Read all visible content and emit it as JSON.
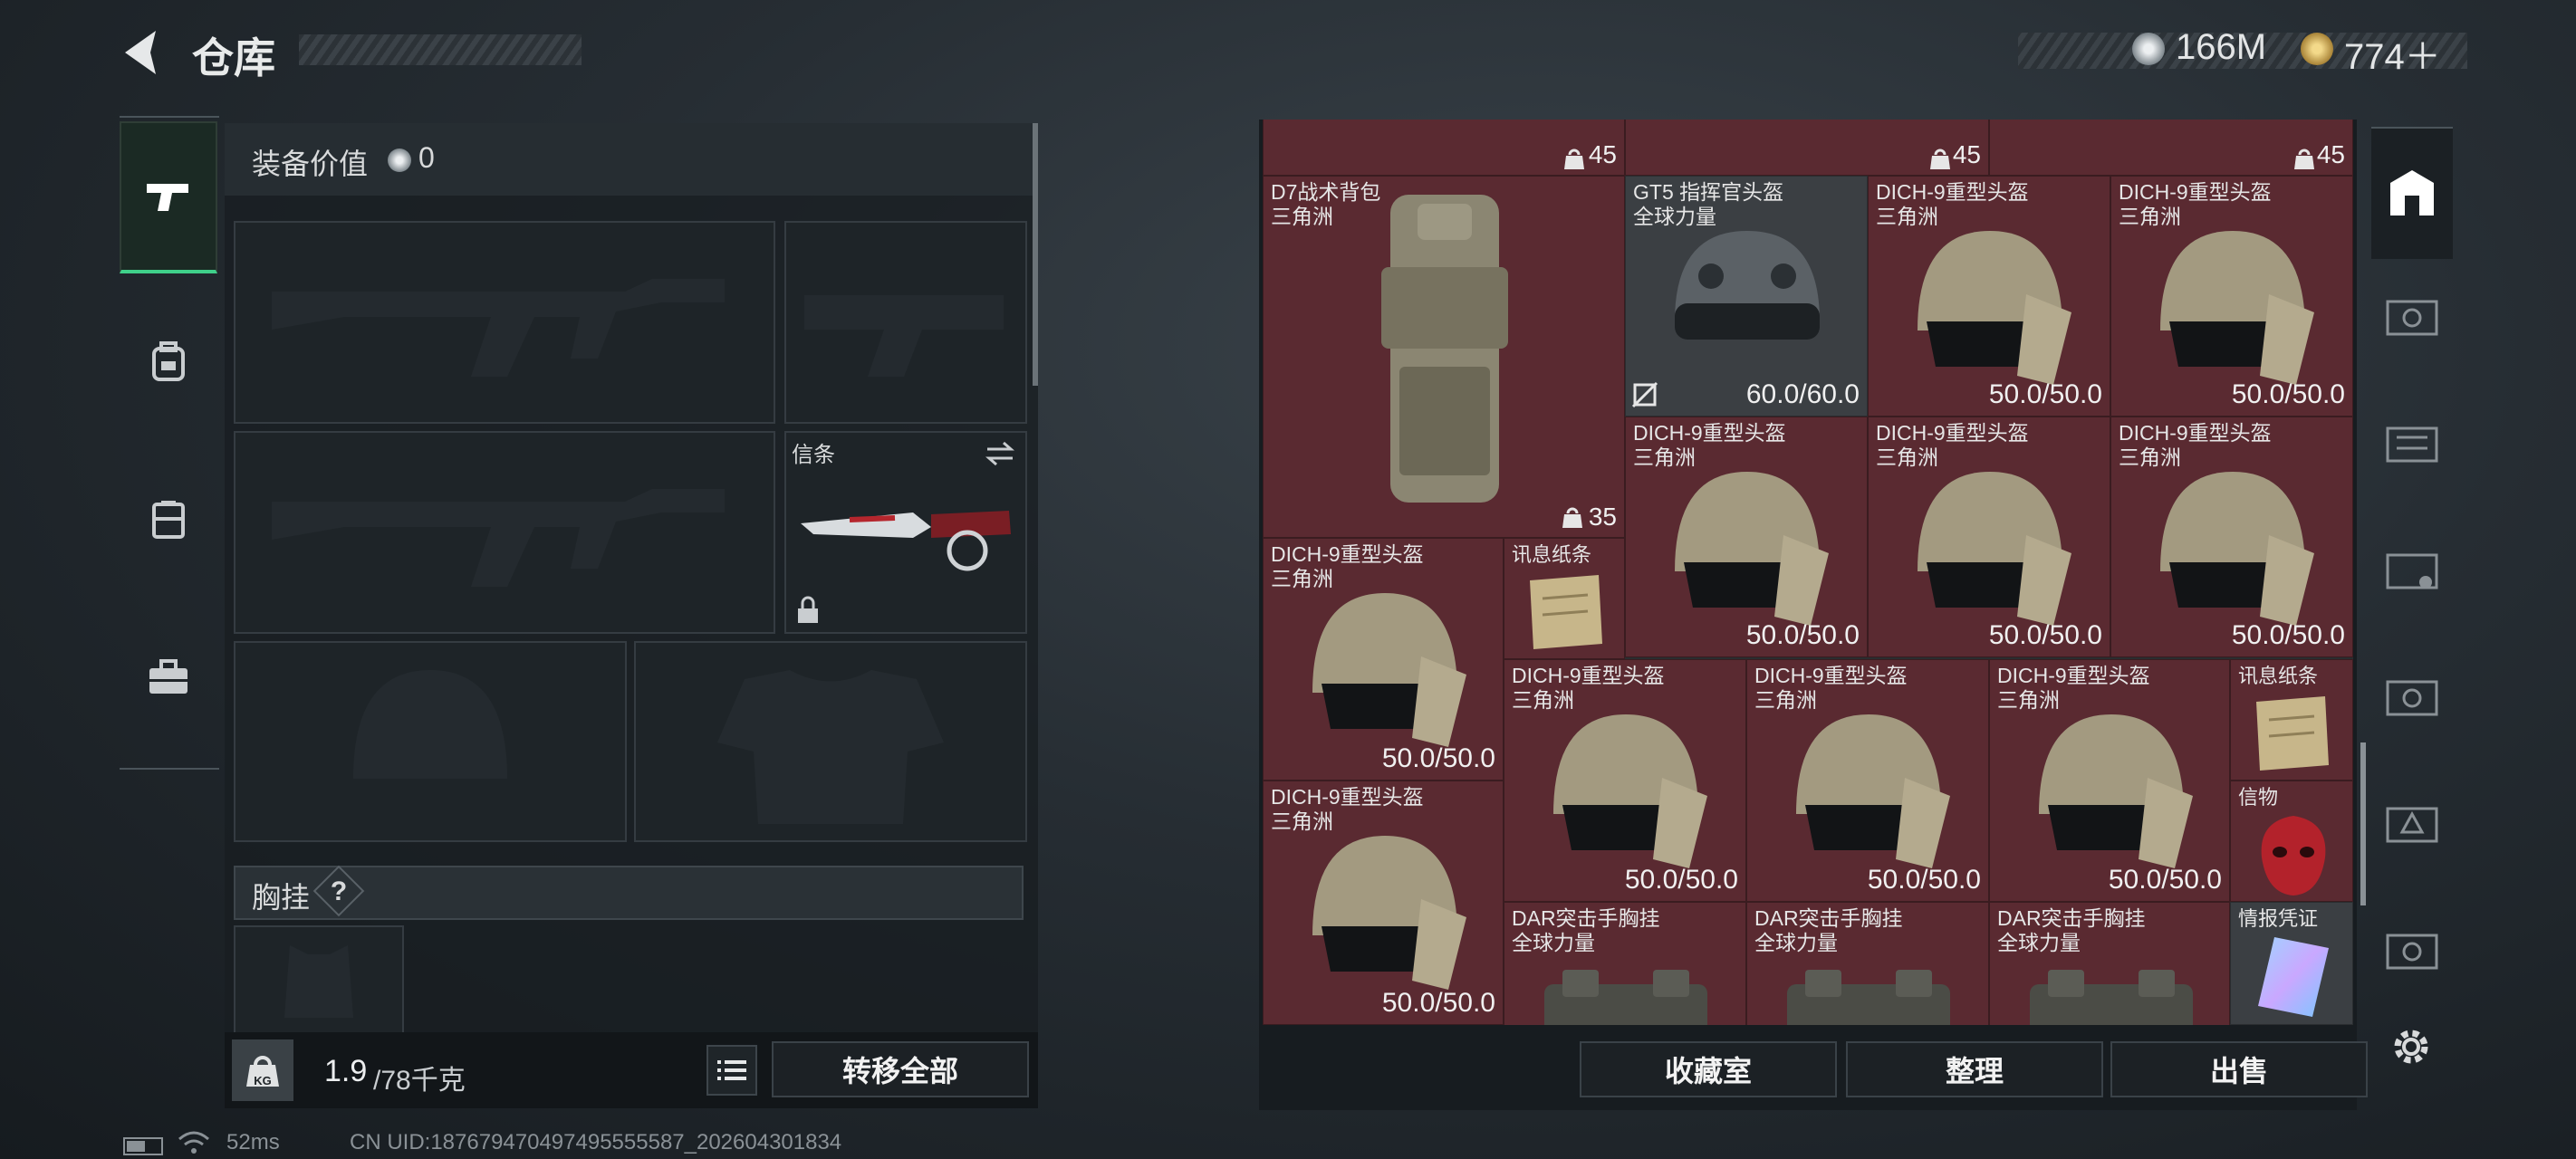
{
  "header": {
    "title": "仓库",
    "currency_silver": "166M",
    "currency_gold": "774＋"
  },
  "loadout": {
    "equip_value_label": "装备价值",
    "equip_value": "0",
    "melee_slot_label": "信条",
    "chest_rig_label": "胸挂",
    "chest_rig_help": "?"
  },
  "weight": {
    "value": "1.9",
    "capacity": "/78千克",
    "icon_text": "KG"
  },
  "buttons": {
    "transfer_all": "转移全部",
    "collection": "收藏室",
    "sort": "整理",
    "sell": "出售"
  },
  "inventory": {
    "top_row": [
      {
        "weight": "45"
      },
      {
        "weight": "45"
      },
      {
        "weight": "45"
      }
    ],
    "items": [
      {
        "name": "D7战术背包\n三角洲",
        "value": "",
        "weight": "35"
      },
      {
        "name": "GT5 指挥官头盔\n全球力量",
        "value": "60.0/60.0"
      },
      {
        "name": "DICH-9重型头盔\n三角洲",
        "value": "50.0/50.0"
      },
      {
        "name": "DICH-9重型头盔\n三角洲",
        "value": "50.0/50.0"
      },
      {
        "name": "DICH-9重型头盔\n三角洲",
        "value": "50.0/50.0"
      },
      {
        "name": "DICH-9重型头盔\n三角洲",
        "value": "50.0/50.0"
      },
      {
        "name": "DICH-9重型头盔\n三角洲",
        "value": "50.0/50.0"
      },
      {
        "name": "DICH-9重型头盔\n三角洲",
        "value": "50.0/50.0"
      },
      {
        "name": "讯息纸条",
        "value": ""
      },
      {
        "name": "DICH-9重型头盔\n三角洲",
        "value": "50.0/50.0"
      },
      {
        "name": "DICH-9重型头盔\n三角洲",
        "value": "50.0/50.0"
      },
      {
        "name": "DICH-9重型头盔\n三角洲",
        "value": "50.0/50.0"
      },
      {
        "name": "讯息纸条",
        "value": ""
      },
      {
        "name": "DICH-9重型头盔\n三角洲",
        "value": "50.0/50.0"
      },
      {
        "name": "信物",
        "value": ""
      },
      {
        "name": "DAR突击手胸挂\n全球力量",
        "value": ""
      },
      {
        "name": "DAR突击手胸挂\n全球力量",
        "value": ""
      },
      {
        "name": "DAR突击手胸挂\n全球力量",
        "value": ""
      },
      {
        "name": "情报凭证",
        "value": ""
      }
    ]
  },
  "footer": {
    "ping": "52ms",
    "uid": "CN UID:187679470497495555587_202604301834"
  },
  "colors": {
    "item_bg": "#5a2a31",
    "accent_green": "#3fd08a"
  }
}
